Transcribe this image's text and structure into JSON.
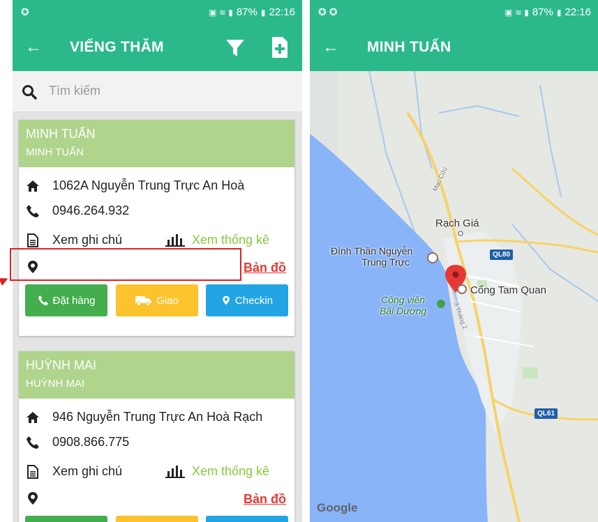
{
  "status_bar": {
    "battery": "87%",
    "time": "22:16"
  },
  "left_screen": {
    "title": "VIẾNG THĂM",
    "search_placeholder": "Tìm kiếm",
    "cards": [
      {
        "name": "MINH TUẤN",
        "subname": "MINH TUẤN",
        "address": "1062A Nguyễn Trung Trực An Hoà",
        "phone": "0946.264.932",
        "notes_link": "Xem ghi chú",
        "stats_link": "Xem thống kê",
        "map_link": "Bản đồ",
        "buttons": {
          "order": "Đặt hàng",
          "deliver": "Giao",
          "checkin": "Checkin"
        }
      },
      {
        "name": "HUỲNH MAI",
        "subname": "HUỲNH MAI",
        "address": "946 Nguyễn Trung Trực An Hoà Rạch",
        "phone": "0908.866.775",
        "notes_link": "Xem ghi chú",
        "stats_link": "Xem thống kê",
        "map_link": "Bản đồ"
      }
    ]
  },
  "right_screen": {
    "title": "MINH TUẤN",
    "map": {
      "city_label": "Rạch Giá",
      "temple_label_1": "Đình Thần Nguyễn",
      "temple_label_2": "Trung Trực",
      "park_label_1": "Công viên",
      "park_label_2": "Bãi Dương",
      "gate_label": "Cổng Tam Quan",
      "road_label_1": "Mạc Cửu",
      "road_label_2": "3 Tháng 2",
      "route_1": "QL80",
      "route_2": "QL61",
      "attribution": "Google"
    }
  },
  "colors": {
    "app_green": "#2bb98c",
    "card_header": "#afd48c",
    "link_green": "#8cc63f",
    "map_link_red": "#e53935",
    "btn_order": "#44ae4e",
    "btn_deliver": "#fcc32c",
    "btn_checkin": "#22a5e4",
    "water": "#8ab4f8"
  }
}
